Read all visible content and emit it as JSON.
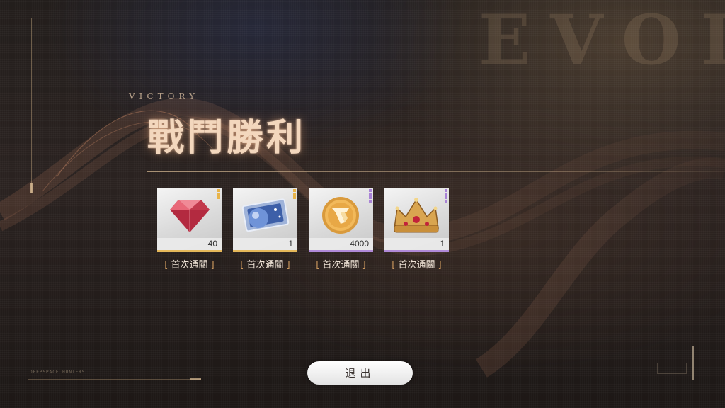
{
  "background": {
    "watermark": "EVOL",
    "footer_brand": "DEEPSPACE HUNTERS"
  },
  "header": {
    "subtitle": "VICTORY",
    "title": "戰鬥勝利"
  },
  "rewards": [
    {
      "item_icon": "red-diamond-icon",
      "quantity": "40",
      "rarity_color": "#e5b85a",
      "label": "首次通關"
    },
    {
      "item_icon": "star-map-ticket-icon",
      "quantity": "1",
      "rarity_color": "#e5b85a",
      "label": "首次通關"
    },
    {
      "item_icon": "gold-coin-icon",
      "quantity": "4000",
      "rarity_color": "#b08ad8",
      "label": "首次通關"
    },
    {
      "item_icon": "gold-crown-icon",
      "quantity": "1",
      "rarity_color": "#b08ad8",
      "label": "首次通關"
    }
  ],
  "bracket_left": "[",
  "bracket_right": "]",
  "exit_button": {
    "label": "退出"
  },
  "colors": {
    "title_glow": "#f3d7bd",
    "accent_bronze": "#c9965c"
  }
}
